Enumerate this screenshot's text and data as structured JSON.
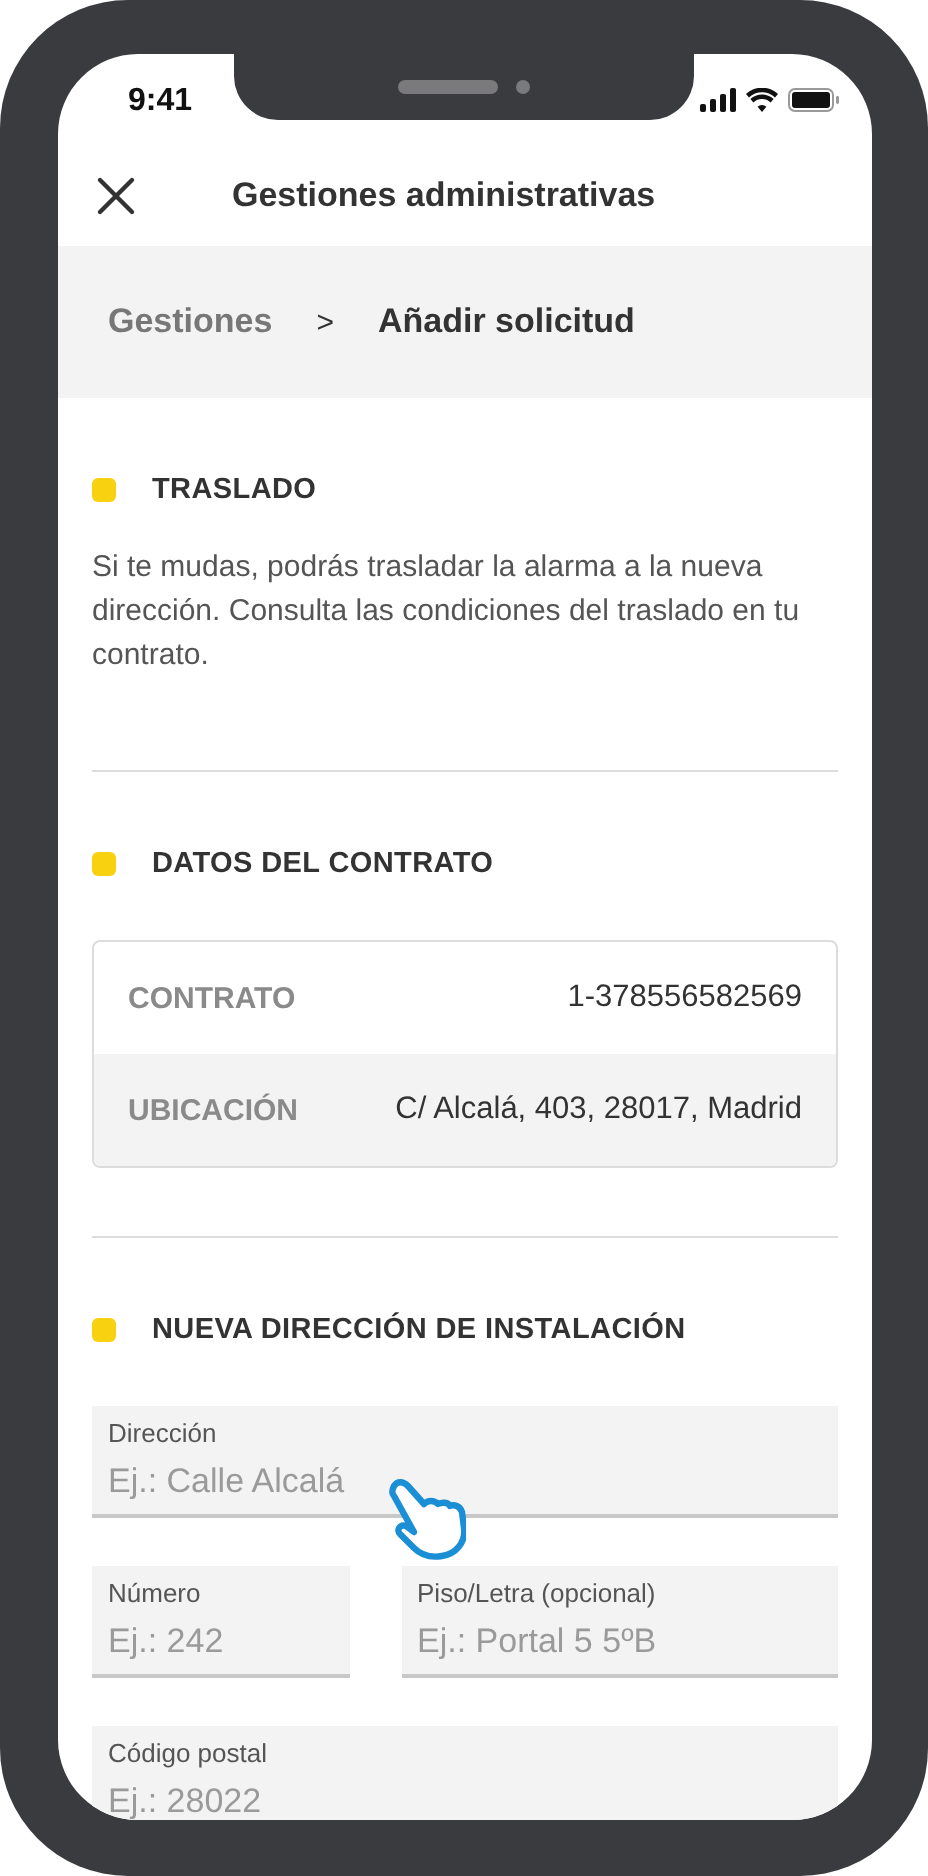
{
  "status_bar": {
    "time": "9:41"
  },
  "header": {
    "title": "Gestiones administrativas"
  },
  "breadcrumb": [
    {
      "label": "Gestiones",
      "current": false
    },
    {
      "label": "Añadir solicitud",
      "current": true
    }
  ],
  "breadcrumb_separator": ">",
  "sections": [
    {
      "kind": "text",
      "title": "TRASLADO",
      "text": "Si te mudas, podrás trasladar la alarma a la nueva dirección. Consulta las condiciones del traslado en tu contrato."
    },
    {
      "kind": "table",
      "title": "DATOS DEL CONTRATO",
      "rows": [
        {
          "label": "CONTRATO",
          "value": "1-378556582569"
        },
        {
          "label": "UBICACIÓN",
          "value": "C/ Alcalá, 403, 28017, Madrid"
        }
      ]
    },
    {
      "kind": "form",
      "title": "NUEVA DIRECCIÓN DE INSTALACIÓN",
      "rows": [
        [
          {
            "label": "Dirección",
            "placeholder": "Ej.: Calle Alcalá"
          }
        ],
        [
          {
            "label": "Número",
            "placeholder": "Ej.: 242"
          },
          {
            "label": "Piso/Letra (opcional)",
            "placeholder": "Ej.: Portal 5 5ºB"
          }
        ],
        [
          {
            "label": "Código postal",
            "placeholder": "Ej.: 28022"
          }
        ]
      ]
    }
  ]
}
